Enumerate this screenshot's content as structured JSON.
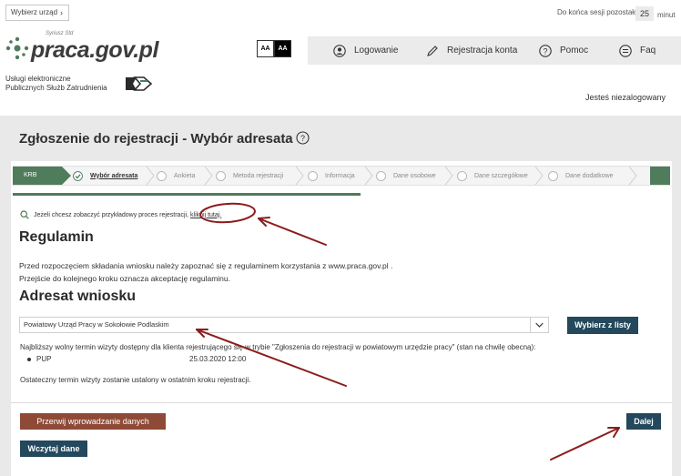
{
  "header": {
    "office_button": "Wybierz urząd",
    "session_label": "Do końca sesji pozostało",
    "session_minutes": "25",
    "session_unit": "minut",
    "logo_text": "praca.gov.pl",
    "logo_sup": "Syriusz Std",
    "services_line1": "Usługi elektroniczne",
    "services_line2": "Publicznych Służb Zatrudnienia",
    "contrast_a": "AA",
    "contrast_b": "AA",
    "nav": {
      "login": "Logowanie",
      "register": "Rejestracja konta",
      "help": "Pomoc",
      "faq": "Faq"
    },
    "login_status": "Jesteś niezalogowany"
  },
  "page": {
    "title": "Zgłoszenie do rejestracji - Wybór adresata"
  },
  "stepper": {
    "first": "KRB",
    "steps": [
      "Wybór adresata",
      "Ankieta",
      "Metoda rejestracji",
      "Informacja",
      "Dane osobowe",
      "Dane szczegółowe",
      "Dane dodatkowe"
    ]
  },
  "sample": {
    "text": "Jeżeli chcesz zobaczyć przykładowy proces rejestracji,",
    "link": "kliknij tutaj."
  },
  "regulamin": {
    "heading": "Regulamin",
    "line1": "Przed rozpoczęciem składania wniosku należy zapoznać się z regulaminem korzystania z www.praca.gov.pl .",
    "line2": "Przejście do kolejnego kroku oznacza akceptację regulaminu."
  },
  "adresat": {
    "heading": "Adresat wniosku",
    "selected_office": "Powiatowy Urząd Pracy w Sokołowie Podlaskim",
    "choose_button": "Wybierz z listy",
    "visit_info": "Najbliższy wolny termin wizyty dostępny dla klienta rejestrującego się w trybie \"Zgłoszenia do rejestracji w powiatowym urzędzie pracy\" (stan na chwilę obecną):",
    "visit_type": "PUP",
    "visit_date": "25.03.2020 12:00",
    "final_info": "Ostateczny termin wizyty zostanie ustalony w ostatnim kroku rejestracji."
  },
  "actions": {
    "cancel": "Przerwij wprowadzanie danych",
    "next": "Dalej",
    "load": "Wczytaj dane"
  },
  "colors": {
    "primary_button": "#24485c",
    "cancel_button": "#8e4a36",
    "stepper_green": "#4f7c5a",
    "annotation_red": "#8b1c1c"
  }
}
